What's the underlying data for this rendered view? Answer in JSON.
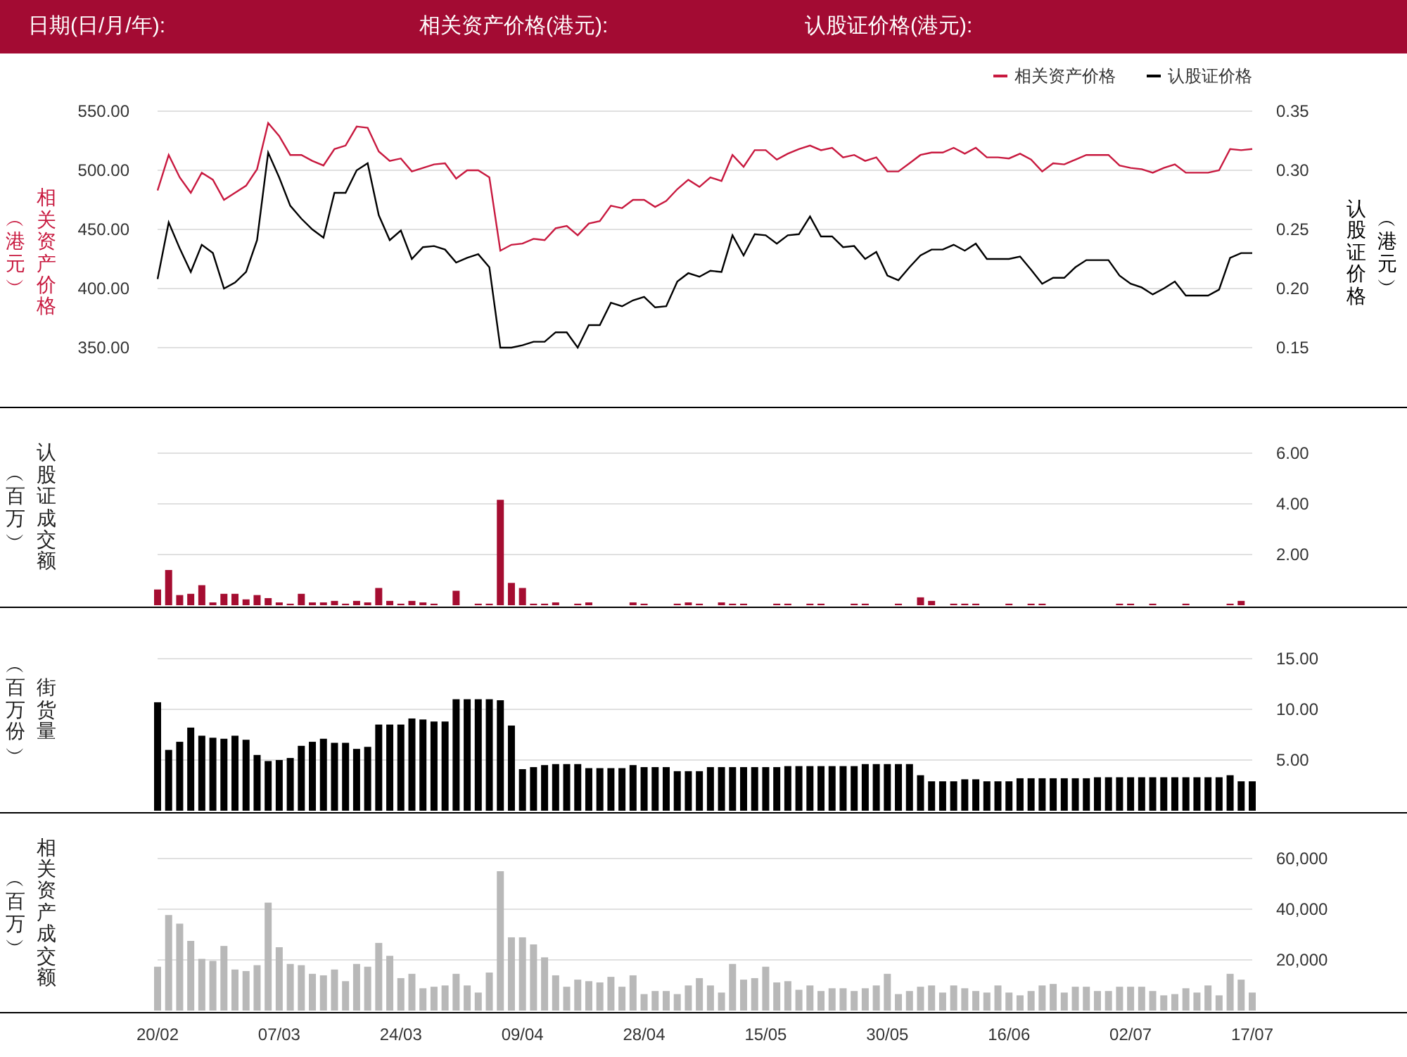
{
  "header": {
    "fields": [
      "日期(日/月/年):",
      "相关资产价格(港元):",
      "认股证价格(港元):"
    ]
  },
  "price_panel": {
    "left_label": "相关资产价格",
    "left_unit": "︵港元︶",
    "right_label": "认股证价格",
    "right_unit": "︵港元︶",
    "chart_data": {
      "type": "line",
      "grid": true,
      "legend": true,
      "ylim": [
        350,
        550
      ],
      "y2lim": [
        0.15,
        0.35
      ],
      "y2ticks": [
        {
          "value": 0.15,
          "label": "0.15"
        },
        {
          "value": 0.2,
          "label": "0.20"
        },
        {
          "value": 0.25,
          "label": "0.25"
        },
        {
          "value": 0.3,
          "label": "0.30"
        },
        {
          "value": 0.35,
          "label": "0.35"
        }
      ],
      "yticks": [
        {
          "value": 350,
          "label": "350.00"
        },
        {
          "value": 400,
          "label": "400.00"
        },
        {
          "value": 450,
          "label": "450.00"
        },
        {
          "value": 500,
          "label": "500.00"
        },
        {
          "value": 550,
          "label": "550.00"
        }
      ],
      "series": [
        {
          "name": "相关资产价格",
          "color": "#c8193f",
          "values": [
            483,
            513,
            494,
            481,
            498,
            492,
            475,
            481,
            487,
            501,
            540,
            529,
            513,
            513,
            508,
            504,
            518,
            521,
            537,
            536,
            516,
            508,
            510,
            499,
            502,
            505,
            506,
            493,
            500,
            500,
            494,
            432,
            437,
            438,
            442,
            441,
            451,
            453,
            445,
            455,
            457,
            470,
            468,
            475,
            475,
            469,
            474,
            484,
            492,
            486,
            494,
            491,
            513,
            503,
            517,
            517,
            509,
            514,
            518,
            521,
            517,
            519,
            511,
            513,
            508,
            511,
            499,
            499,
            506,
            513,
            515,
            515,
            519,
            514,
            519,
            511,
            511,
            510,
            514,
            509,
            499,
            506,
            505,
            509,
            513,
            513,
            513,
            504,
            502,
            501,
            498,
            502,
            505,
            498,
            498,
            498,
            500,
            518,
            517,
            518
          ]
        },
        {
          "name": "认股证价格",
          "color": "#000000",
          "axis": "y2",
          "values": [
            0.208,
            0.256,
            0.234,
            0.214,
            0.237,
            0.23,
            0.2,
            0.205,
            0.214,
            0.241,
            0.315,
            0.294,
            0.27,
            0.259,
            0.25,
            0.243,
            0.281,
            0.281,
            0.3,
            0.306,
            0.262,
            0.241,
            0.249,
            0.225,
            0.235,
            0.236,
            0.233,
            0.222,
            0.226,
            0.229,
            0.218,
            0.15,
            0.15,
            0.152,
            0.155,
            0.155,
            0.163,
            0.163,
            0.15,
            0.169,
            0.169,
            0.188,
            0.185,
            0.19,
            0.193,
            0.184,
            0.185,
            0.206,
            0.213,
            0.21,
            0.215,
            0.214,
            0.245,
            0.228,
            0.246,
            0.245,
            0.238,
            0.245,
            0.246,
            0.261,
            0.244,
            0.244,
            0.235,
            0.236,
            0.225,
            0.231,
            0.211,
            0.207,
            0.218,
            0.228,
            0.233,
            0.233,
            0.237,
            0.232,
            0.238,
            0.225,
            0.225,
            0.225,
            0.227,
            0.216,
            0.204,
            0.209,
            0.209,
            0.218,
            0.224,
            0.224,
            0.224,
            0.211,
            0.204,
            0.201,
            0.195,
            0.2,
            0.206,
            0.194,
            0.194,
            0.194,
            0.199,
            0.226,
            0.23,
            0.23
          ]
        }
      ]
    }
  },
  "warrant_turnover_panel": {
    "label": "认股证成交额",
    "unit": "︵百万︶",
    "chart_data": {
      "type": "bar",
      "grid": true,
      "ylim": [
        0,
        6
      ],
      "yticks": [
        {
          "value": 2,
          "label": "2.00"
        },
        {
          "value": 4,
          "label": "4.00"
        },
        {
          "value": 6,
          "label": "6.00"
        }
      ],
      "series": [
        {
          "color": "#a50d31",
          "values": [
            0.62,
            1.39,
            0.4,
            0.45,
            0.79,
            0.11,
            0.45,
            0.45,
            0.23,
            0.4,
            0.28,
            0.11,
            0.06,
            0.45,
            0.11,
            0.11,
            0.17,
            0.06,
            0.17,
            0.11,
            0.68,
            0.17,
            0.06,
            0.17,
            0.11,
            0.06,
            0,
            0.57,
            0,
            0.06,
            0.06,
            4.16,
            0.88,
            0.68,
            0.06,
            0.06,
            0.11,
            0,
            0.06,
            0.11,
            0,
            0,
            0,
            0.11,
            0.06,
            0,
            0,
            0.06,
            0.11,
            0.06,
            0,
            0.11,
            0.06,
            0.06,
            0,
            0,
            0.06,
            0.06,
            0,
            0.06,
            0.06,
            0,
            0,
            0.06,
            0.06,
            0,
            0,
            0.06,
            0,
            0.31,
            0.17,
            0,
            0.06,
            0.06,
            0.06,
            0,
            0,
            0.06,
            0,
            0.06,
            0.06,
            0,
            0,
            0,
            0,
            0,
            0,
            0.06,
            0.06,
            0,
            0.06,
            0,
            0,
            0.06,
            0,
            0,
            0,
            0.06,
            0.17,
            0
          ]
        }
      ]
    }
  },
  "outstanding_panel": {
    "label": "街货量",
    "unit": "︵百万份︶",
    "chart_data": {
      "type": "bar",
      "grid": true,
      "ylim": [
        0,
        15
      ],
      "yticks": [
        {
          "value": 5,
          "label": "5.00"
        },
        {
          "value": 10,
          "label": "10.00"
        },
        {
          "value": 15,
          "label": "15.00"
        }
      ],
      "series": [
        {
          "color": "#000000",
          "values": [
            10.7,
            6.0,
            6.8,
            8.2,
            7.4,
            7.2,
            7.1,
            7.4,
            7.0,
            5.5,
            4.9,
            5.0,
            5.2,
            6.4,
            6.8,
            7.1,
            6.7,
            6.7,
            6.1,
            6.3,
            8.5,
            8.5,
            8.5,
            9.1,
            9.0,
            8.8,
            8.8,
            11.0,
            11.0,
            11.0,
            11.0,
            10.9,
            8.4,
            4.1,
            4.3,
            4.5,
            4.6,
            4.6,
            4.6,
            4.2,
            4.2,
            4.2,
            4.2,
            4.5,
            4.3,
            4.3,
            4.3,
            3.9,
            3.9,
            3.9,
            4.3,
            4.3,
            4.3,
            4.3,
            4.3,
            4.3,
            4.3,
            4.4,
            4.4,
            4.4,
            4.4,
            4.4,
            4.4,
            4.4,
            4.6,
            4.6,
            4.6,
            4.6,
            4.6,
            3.5,
            2.9,
            2.9,
            2.9,
            3.1,
            3.1,
            2.9,
            2.9,
            2.9,
            3.2,
            3.2,
            3.2,
            3.2,
            3.2,
            3.2,
            3.2,
            3.3,
            3.3,
            3.3,
            3.3,
            3.3,
            3.3,
            3.3,
            3.3,
            3.3,
            3.3,
            3.3,
            3.3,
            3.5,
            2.9,
            2.9
          ]
        }
      ]
    }
  },
  "underlying_turnover_panel": {
    "label": "相关资产成交额",
    "unit": "︵百万︶",
    "chart_data": {
      "type": "bar",
      "grid": true,
      "ylim": [
        0,
        60000
      ],
      "yticks": [
        {
          "value": 20000,
          "label": "20,000"
        },
        {
          "value": 40000,
          "label": "40,000"
        },
        {
          "value": 60000,
          "label": "60,000"
        }
      ],
      "categories": [
        "20/02",
        null,
        null,
        null,
        null,
        null,
        null,
        null,
        null,
        null,
        null,
        "07/03",
        null,
        null,
        null,
        null,
        null,
        null,
        null,
        null,
        null,
        null,
        "24/03",
        null,
        null,
        null,
        null,
        null,
        null,
        null,
        null,
        null,
        null,
        "09/04",
        null,
        null,
        null,
        null,
        null,
        null,
        null,
        null,
        null,
        null,
        "28/04",
        null,
        null,
        null,
        null,
        null,
        null,
        null,
        null,
        null,
        null,
        "15/05",
        null,
        null,
        null,
        null,
        null,
        null,
        null,
        null,
        null,
        null,
        "30/05",
        null,
        null,
        null,
        null,
        null,
        null,
        null,
        null,
        null,
        null,
        "16/06",
        null,
        null,
        null,
        null,
        null,
        null,
        null,
        null,
        null,
        null,
        "02/07",
        null,
        null,
        null,
        null,
        null,
        null,
        null,
        null,
        null,
        null,
        "17/07"
      ],
      "series": [
        {
          "color": "#b8b8b8",
          "values": [
            17300,
            37700,
            34300,
            27500,
            20400,
            19600,
            25500,
            16200,
            15600,
            17900,
            42600,
            25000,
            18400,
            17900,
            14500,
            13900,
            16200,
            11600,
            18400,
            17300,
            26700,
            21600,
            12800,
            14500,
            8800,
            9400,
            9900,
            14500,
            9900,
            7100,
            15000,
            55000,
            28900,
            28900,
            26100,
            21000,
            13900,
            9400,
            12200,
            11600,
            11100,
            13300,
            9400,
            13900,
            6500,
            7700,
            7700,
            6500,
            9900,
            12800,
            9900,
            7100,
            18400,
            12200,
            12800,
            17300,
            11100,
            11600,
            8200,
            9900,
            7700,
            8800,
            8800,
            7700,
            8800,
            9900,
            14500,
            6500,
            7700,
            9400,
            9900,
            7100,
            9900,
            8800,
            7700,
            7100,
            9900,
            7100,
            6000,
            7700,
            9900,
            10500,
            7100,
            9400,
            9400,
            7700,
            7700,
            9400,
            9400,
            9400,
            7700,
            6000,
            6500,
            8800,
            7100,
            9900,
            6000,
            14500,
            12200,
            7100
          ]
        }
      ]
    }
  }
}
